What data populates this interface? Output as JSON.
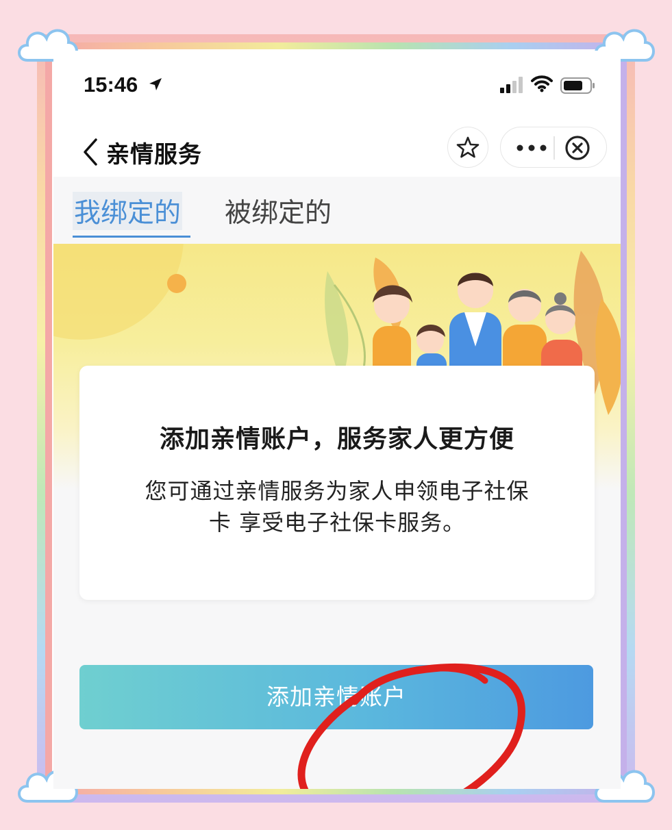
{
  "status_bar": {
    "time": "15:46",
    "icons": [
      "location-arrow-icon",
      "signal-icon",
      "wifi-icon",
      "battery-icon"
    ]
  },
  "nav": {
    "title": "亲情服务",
    "back_icon": "chevron-left-icon",
    "star_icon": "star-icon",
    "more_icon": "more-dots-icon",
    "close_icon": "close-circle-icon"
  },
  "tabs": [
    {
      "label": "我绑定的",
      "active": true
    },
    {
      "label": "被绑定的",
      "active": false
    }
  ],
  "card": {
    "title": "添加亲情账户，服务家人更方便",
    "description_line1": "您可通过亲情服务为家人申领电子社保",
    "description_line2": "卡 享受电子社保卡服务。"
  },
  "primary_button": {
    "label": "添加亲情账户"
  },
  "colors": {
    "accent": "#4a8fd6",
    "button_gradient_start": "#6fcfd0",
    "button_gradient_end": "#4d9ae0",
    "annotation_red": "#e0201d",
    "page_background": "#fbdde3"
  }
}
